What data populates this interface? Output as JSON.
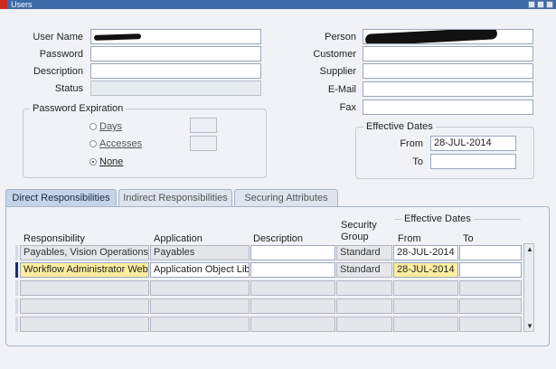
{
  "window": {
    "title": "Users"
  },
  "form": {
    "user_name_label": "User Name",
    "password_label": "Password",
    "description_label": "Description",
    "status_label": "Status",
    "person_label": "Person",
    "customer_label": "Customer",
    "supplier_label": "Supplier",
    "email_label": "E-Mail",
    "fax_label": "Fax"
  },
  "password_expiration": {
    "title": "Password Expiration",
    "options": [
      {
        "label": "Days",
        "selected": false
      },
      {
        "label": "Accesses",
        "selected": false
      },
      {
        "label": "None",
        "selected": true
      }
    ]
  },
  "effective_dates_top": {
    "title": "Effective Dates",
    "from_label": "From",
    "from_value": "28-JUL-2014",
    "to_label": "To",
    "to_value": ""
  },
  "tabs": [
    {
      "label": "Direct Responsibilities",
      "active": true
    },
    {
      "label": "Indirect Responsibilities",
      "active": false
    },
    {
      "label": "Securing Attributes",
      "active": false
    }
  ],
  "grid": {
    "effective_dates_label": "Effective Dates",
    "headers": {
      "responsibility": "Responsibility",
      "application": "Application",
      "description": "Description",
      "security_group_line1": "Security",
      "security_group_line2": "Group",
      "from": "From",
      "to": "To"
    },
    "rows": [
      {
        "responsibility": "Payables, Vision Operations",
        "application": "Payables",
        "description": "",
        "security_group": "Standard",
        "from": "28-JUL-2014",
        "to": ""
      },
      {
        "responsibility": "Workflow Administrator Web",
        "application": "Application Object Libi",
        "description": "",
        "security_group": "Standard",
        "from": "28-JUL-2014",
        "to": ""
      },
      {
        "responsibility": "",
        "application": "",
        "description": "",
        "security_group": "",
        "from": "",
        "to": ""
      },
      {
        "responsibility": "",
        "application": "",
        "description": "",
        "security_group": "",
        "from": "",
        "to": ""
      },
      {
        "responsibility": "",
        "application": "",
        "description": "",
        "security_group": "",
        "from": "",
        "to": ""
      }
    ]
  },
  "colors": {
    "titlebar": "#3d6aa8",
    "highlight": "#ffeea0",
    "background": "#f0f2f7"
  }
}
